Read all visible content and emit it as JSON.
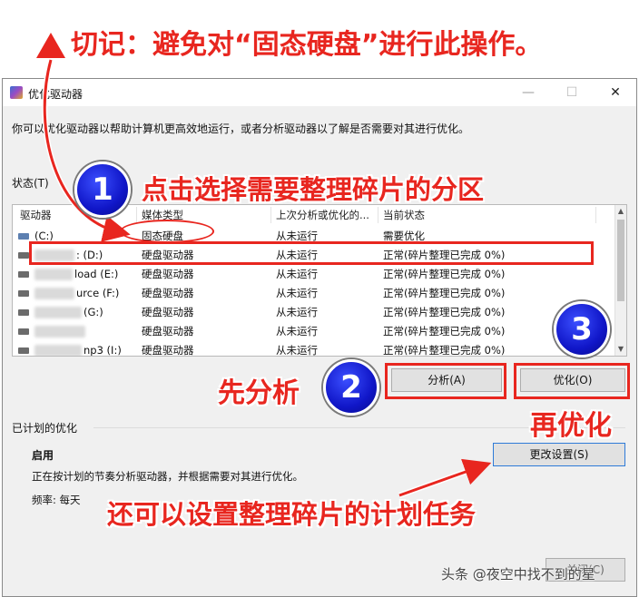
{
  "banner": {
    "symbol": "▲",
    "text": "切记：避免对“固态硬盘”进行此操作。"
  },
  "window": {
    "title": "优化驱动器",
    "controls": {
      "minimize": "—",
      "maximize": "☐",
      "close": "✕"
    },
    "description": "你可以优化驱动器以帮助计算机更高效地运行，或者分析驱动器以了解是否需要对其进行优化。",
    "status_label": "状态(T)",
    "columns": [
      "驱动器",
      "媒体类型",
      "上次分析或优化的...",
      "当前状态"
    ],
    "drives": [
      {
        "drive": "(C:)",
        "media": "固态硬盘",
        "last": "从未运行",
        "status": "需要优化",
        "icon": "ssd-drive-icon"
      },
      {
        "drive": ": (D:)",
        "media": "硬盘驱动器",
        "last": "从未运行",
        "status": "正常(碎片整理已完成 0%)",
        "icon": "hdd-drive-icon"
      },
      {
        "drive": "load (E:)",
        "media": "硬盘驱动器",
        "last": "从未运行",
        "status": "正常(碎片整理已完成 0%)",
        "icon": "hdd-drive-icon"
      },
      {
        "drive": "urce (F:)",
        "media": "硬盘驱动器",
        "last": "从未运行",
        "status": "正常(碎片整理已完成 0%)",
        "icon": "hdd-drive-icon"
      },
      {
        "drive": "(G:)",
        "media": "硬盘驱动器",
        "last": "从未运行",
        "status": "正常(碎片整理已完成 0%)",
        "icon": "hdd-drive-icon"
      },
      {
        "drive": "",
        "media": "硬盘驱动器",
        "last": "从未运行",
        "status": "正常(碎片整理已完成 0%)",
        "icon": "hdd-drive-icon"
      },
      {
        "drive": "np3 (I:)",
        "media": "硬盘驱动器",
        "last": "从未运行",
        "status": "正常(碎片整理已完成 0%)",
        "icon": "hdd-drive-icon"
      }
    ],
    "buttons": {
      "analyze": "分析(A)",
      "optimize": "优化(O)",
      "change_settings": "更改设置(S)",
      "close": "关闭(C)"
    },
    "schedule": {
      "title": "已计划的优化",
      "status": "启用",
      "desc": "正在按计划的节奏分析驱动器，并根据需要对其进行优化。",
      "freq": "频率: 每天"
    }
  },
  "annotations": {
    "step1_number": "1",
    "step1_text": "点击选择需要整理碎片的分区",
    "step2_number": "2",
    "step2_text": "先分析",
    "step3_number": "3",
    "step3_text": "再优化",
    "schedule_text": "还可以设置整理碎片的计划任务",
    "watermark": "头条 @夜空中找不到的星"
  },
  "colors": {
    "annotation_red": "#e8261f",
    "badge_blue": "#1016c8",
    "focus_blue": "#2e7bd8"
  }
}
